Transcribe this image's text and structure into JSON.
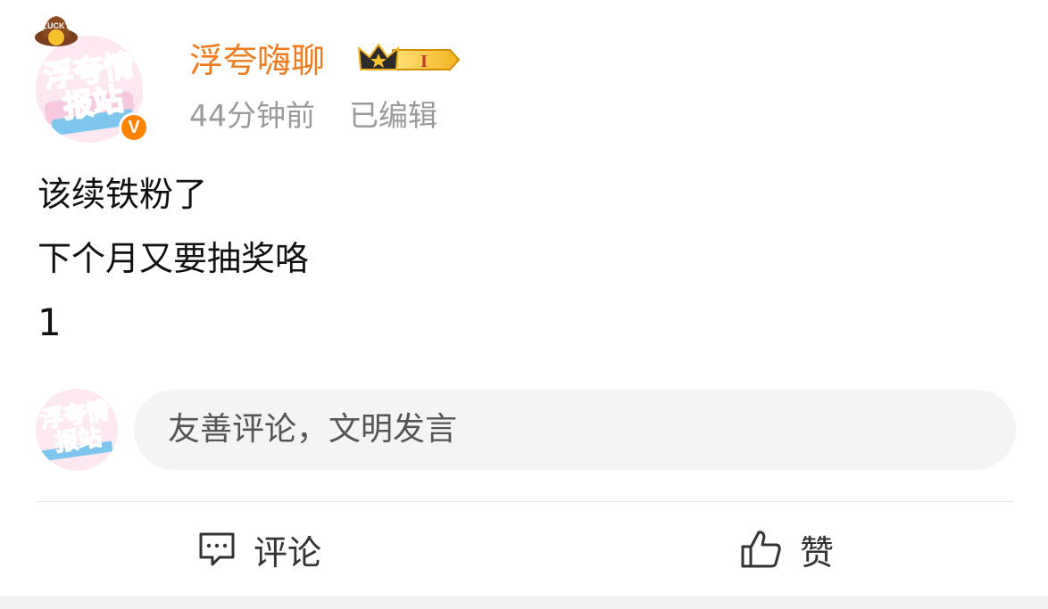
{
  "post": {
    "author": "浮夸嗨聊",
    "vip_level": "I",
    "time": "44分钟前",
    "edited": "已编辑",
    "content_lines": [
      "该续铁粉了",
      "下个月又要抽奖咯",
      "1"
    ]
  },
  "avatar": {
    "text": "浮夸情报站",
    "badge_text": "LUCKY",
    "verified_mark": "V"
  },
  "comment_input": {
    "placeholder": "友善评论，文明发言"
  },
  "actions": {
    "comment_label": "评论",
    "like_label": "赞"
  },
  "colors": {
    "username": "#f07a1e",
    "verified": "#ff8200",
    "meta": "#9a9a9a"
  }
}
